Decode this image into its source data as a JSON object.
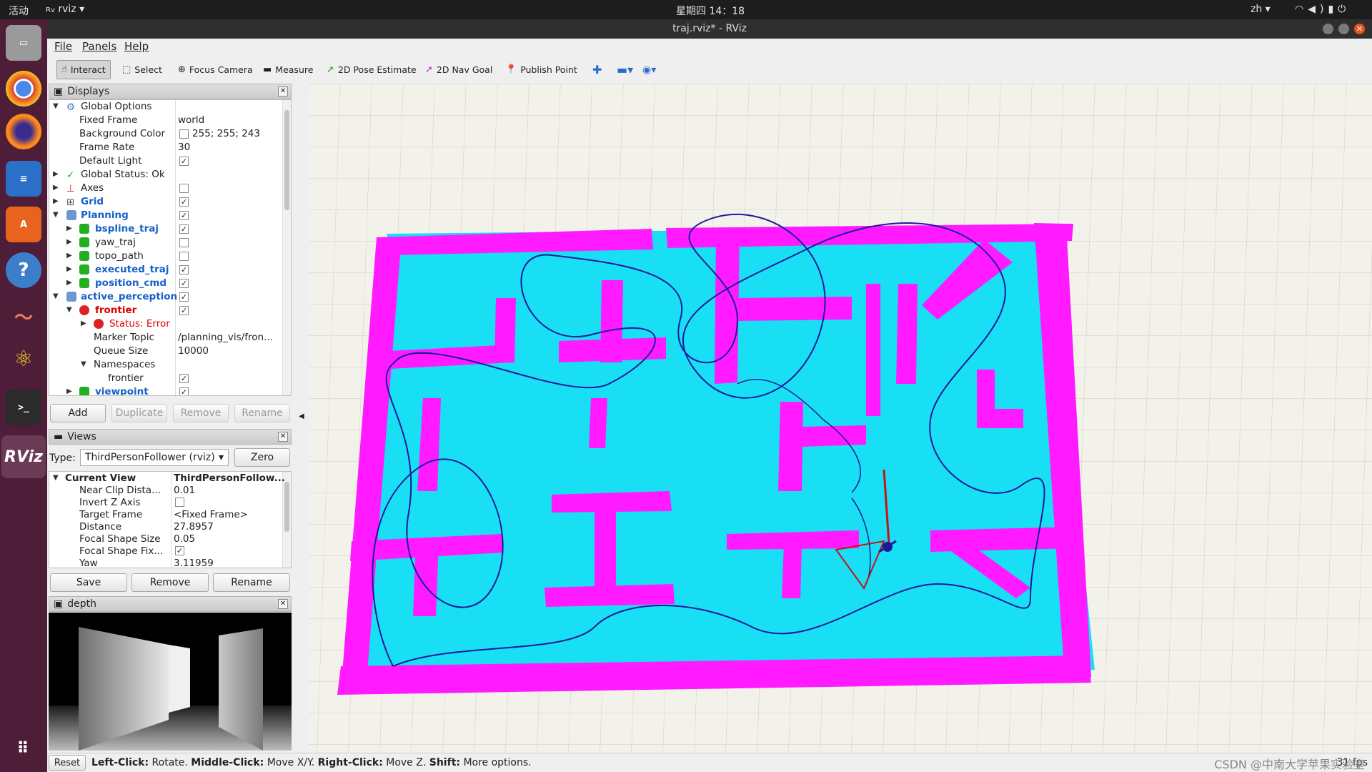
{
  "topbar": {
    "activities": "活动",
    "app_menu": "rviz",
    "clock": "星期四 14：18",
    "lang": "zh"
  },
  "window": {
    "title": "traj.rviz* - RViz"
  },
  "menu": {
    "file": "File",
    "panels": "Panels",
    "help": "Help"
  },
  "toolbar": {
    "interact": "Interact",
    "select": "Select",
    "focus_camera": "Focus Camera",
    "measure": "Measure",
    "pose_estimate": "2D Pose Estimate",
    "nav_goal": "2D Nav Goal",
    "publish_point": "Publish Point"
  },
  "displays": {
    "title": "Displays",
    "rows": [
      {
        "label": "Global Options",
        "value": ""
      },
      {
        "label": "Fixed Frame",
        "value": "world"
      },
      {
        "label": "Background Color",
        "value": "255; 255; 243"
      },
      {
        "label": "Frame Rate",
        "value": "30"
      },
      {
        "label": "Default Light",
        "value": ""
      },
      {
        "label": "Global Status: Ok",
        "value": ""
      },
      {
        "label": "Axes",
        "value": ""
      },
      {
        "label": "Grid",
        "value": ""
      },
      {
        "label": "Planning",
        "value": ""
      },
      {
        "label": "bspline_traj",
        "value": ""
      },
      {
        "label": "yaw_traj",
        "value": ""
      },
      {
        "label": "topo_path",
        "value": ""
      },
      {
        "label": "executed_traj",
        "value": ""
      },
      {
        "label": "position_cmd",
        "value": ""
      },
      {
        "label": "active_perception",
        "value": ""
      },
      {
        "label": "frontier",
        "value": ""
      },
      {
        "label": "Status: Error",
        "value": ""
      },
      {
        "label": "Marker Topic",
        "value": "/planning_vis/fron..."
      },
      {
        "label": "Queue Size",
        "value": "10000"
      },
      {
        "label": "Namespaces",
        "value": ""
      },
      {
        "label": "frontier",
        "value": ""
      },
      {
        "label": "viewpoint",
        "value": ""
      }
    ],
    "buttons": {
      "add": "Add",
      "duplicate": "Duplicate",
      "remove": "Remove",
      "rename": "Rename"
    }
  },
  "views": {
    "title": "Views",
    "type_label": "Type:",
    "type_value": "ThirdPersonFollower (rviz)",
    "zero": "Zero",
    "rows": [
      {
        "label": "Current View",
        "value": "ThirdPersonFollow..."
      },
      {
        "label": "Near Clip Dista...",
        "value": "0.01"
      },
      {
        "label": "Invert Z Axis",
        "value": ""
      },
      {
        "label": "Target Frame",
        "value": "<Fixed Frame>"
      },
      {
        "label": "Distance",
        "value": "27.8957"
      },
      {
        "label": "Focal Shape Size",
        "value": "0.05"
      },
      {
        "label": "Focal Shape Fix...",
        "value": ""
      },
      {
        "label": "Yaw",
        "value": "3.11959"
      }
    ],
    "buttons": {
      "save": "Save",
      "remove": "Remove",
      "rename": "Rename"
    }
  },
  "depth": {
    "title": "depth"
  },
  "status": {
    "reset": "Reset",
    "left": "Left-Click:",
    "left_desc": "Rotate.",
    "middle": "Middle-Click:",
    "middle_desc": "Move X/Y.",
    "right": "Right-Click:",
    "right_desc": "Move Z.",
    "shift": "Shift:",
    "shift_desc": "More options.",
    "fps": "31 fps",
    "watermark": "CSDN @中南大学苹果实验室"
  },
  "colors": {
    "wall": "#ff1aff",
    "free": "#17e0f5",
    "traj": "#1a1a9a",
    "accent": "#1560c8"
  }
}
